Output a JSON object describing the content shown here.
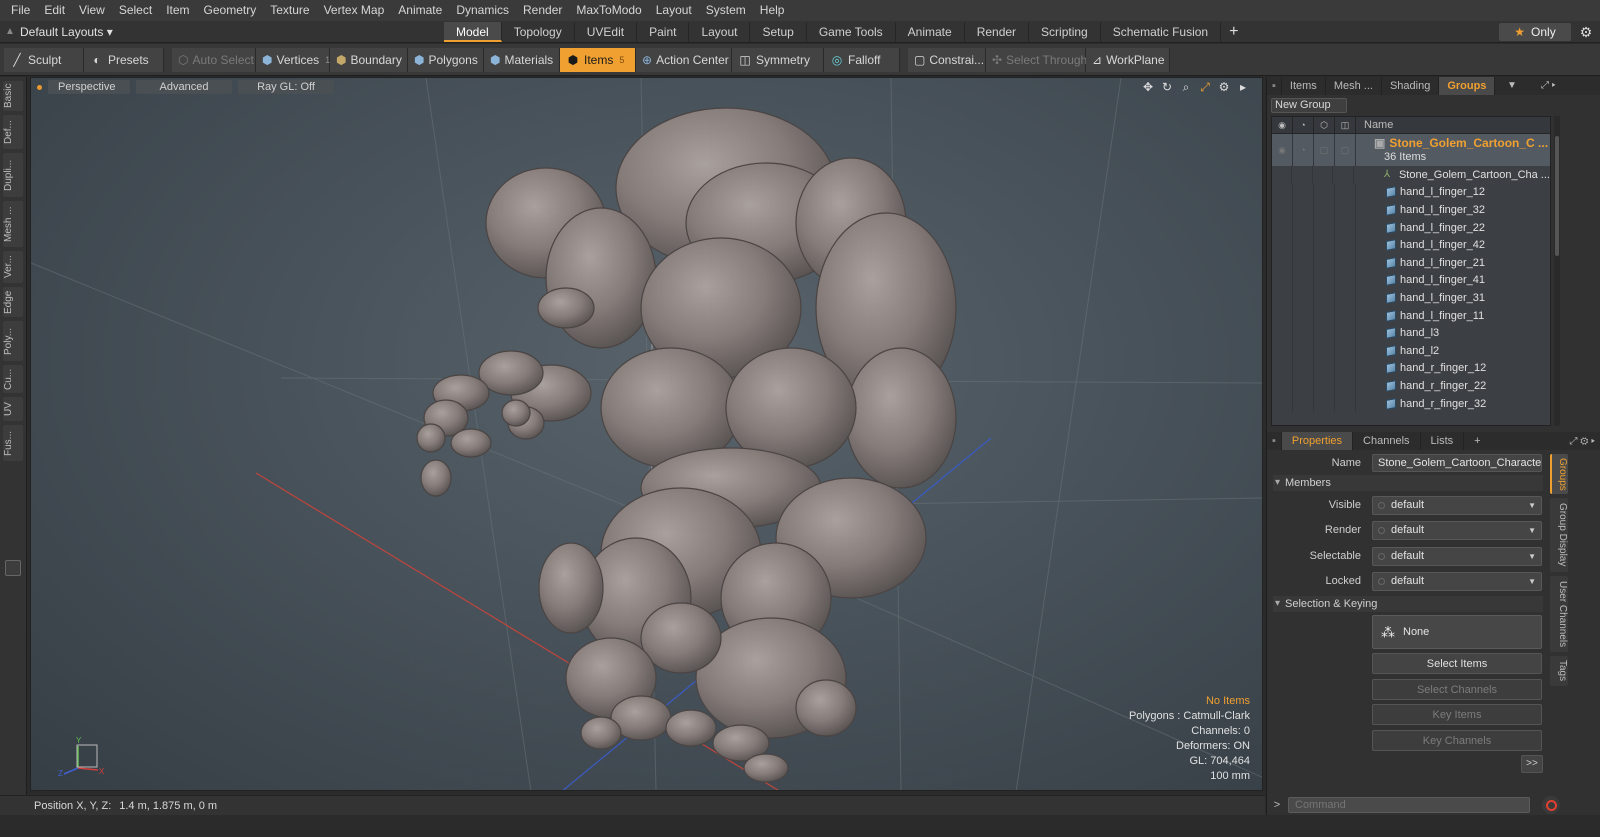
{
  "menu": [
    "File",
    "Edit",
    "View",
    "Select",
    "Item",
    "Geometry",
    "Texture",
    "Vertex Map",
    "Animate",
    "Dynamics",
    "Render",
    "MaxToModo",
    "Layout",
    "System",
    "Help"
  ],
  "layout_select": "Default Layouts",
  "layout_tabs": [
    "Model",
    "Topology",
    "UVEdit",
    "Paint",
    "Layout",
    "Setup",
    "Game Tools",
    "Animate",
    "Render",
    "Scripting",
    "Schematic Fusion"
  ],
  "layout_active": "Model",
  "only_label": "Only",
  "toolbar": {
    "sculpt": "Sculpt",
    "presets": "Presets",
    "auto_select": "Auto Select",
    "vertices": "Vertices",
    "vertices_count": "1",
    "boundary": "Boundary",
    "polygons": "Polygons",
    "materials": "Materials",
    "items": "Items",
    "items_count": "5",
    "action_center": "Action Center",
    "symmetry": "Symmetry",
    "falloff": "Falloff",
    "constraints": "Constrai...",
    "select_through": "Select Through",
    "workplane": "WorkPlane"
  },
  "left_tabs": [
    "Basic",
    "Def...",
    "Dupli...",
    "Mesh ...",
    "Ver...",
    "Edge",
    "Poly...",
    "Cu...",
    "UV",
    "Fus..."
  ],
  "viewport": {
    "perspective": "Perspective",
    "advanced": "Advanced",
    "raygl": "Ray GL: Off",
    "info": {
      "no_items": "No Items",
      "polygons": "Polygons : Catmull-Clark",
      "channels": "Channels: 0",
      "deformers": "Deformers: ON",
      "gl": "GL: 704,464",
      "scale": "100 mm"
    },
    "axis_y": "Y",
    "axis_x": "X",
    "axis_z": "Z"
  },
  "status": {
    "label": "Position X, Y, Z:",
    "value": "1.4 m, 1.875 m, 0 m"
  },
  "groups_panel": {
    "tabs": [
      "Items",
      "Mesh ...",
      "Shading",
      "Groups"
    ],
    "active": "Groups",
    "new_group": "New Group",
    "name_header": "Name",
    "group_name": "Stone_Golem_Cartoon_C ...",
    "group_count": "36 Items",
    "items": [
      {
        "label": "Stone_Golem_Cartoon_Cha ...",
        "type": "locator"
      },
      {
        "label": "hand_l_finger_12",
        "type": "mesh"
      },
      {
        "label": "hand_l_finger_32",
        "type": "mesh"
      },
      {
        "label": "hand_l_finger_22",
        "type": "mesh"
      },
      {
        "label": "hand_l_finger_42",
        "type": "mesh"
      },
      {
        "label": "hand_l_finger_21",
        "type": "mesh"
      },
      {
        "label": "hand_l_finger_41",
        "type": "mesh"
      },
      {
        "label": "hand_l_finger_31",
        "type": "mesh"
      },
      {
        "label": "hand_l_finger_11",
        "type": "mesh"
      },
      {
        "label": "hand_l3",
        "type": "mesh"
      },
      {
        "label": "hand_l2",
        "type": "mesh"
      },
      {
        "label": "hand_r_finger_12",
        "type": "mesh"
      },
      {
        "label": "hand_r_finger_22",
        "type": "mesh"
      },
      {
        "label": "hand_r_finger_32",
        "type": "mesh"
      }
    ]
  },
  "properties": {
    "tabs": [
      "Properties",
      "Channels",
      "Lists"
    ],
    "active": "Properties",
    "name_label": "Name",
    "name_value": "Stone_Golem_Cartoon_Character",
    "members_section": "Members",
    "visible_label": "Visible",
    "visible_value": "default",
    "render_label": "Render",
    "render_value": "default",
    "selectable_label": "Selectable",
    "selectable_value": "default",
    "locked_label": "Locked",
    "locked_value": "default",
    "selection_section": "Selection & Keying",
    "none_label": "None",
    "select_items": "Select Items",
    "select_channels": "Select Channels",
    "key_items": "Key Items",
    "key_channels": "Key Channels",
    "more": ">>"
  },
  "right_vtabs": [
    "Groups",
    "Group Display",
    "User Channels",
    "Tags"
  ],
  "command_placeholder": "Command",
  "colors": {
    "accent": "#f0a030",
    "background": "#2b2b2b",
    "viewport": "#48525a"
  }
}
